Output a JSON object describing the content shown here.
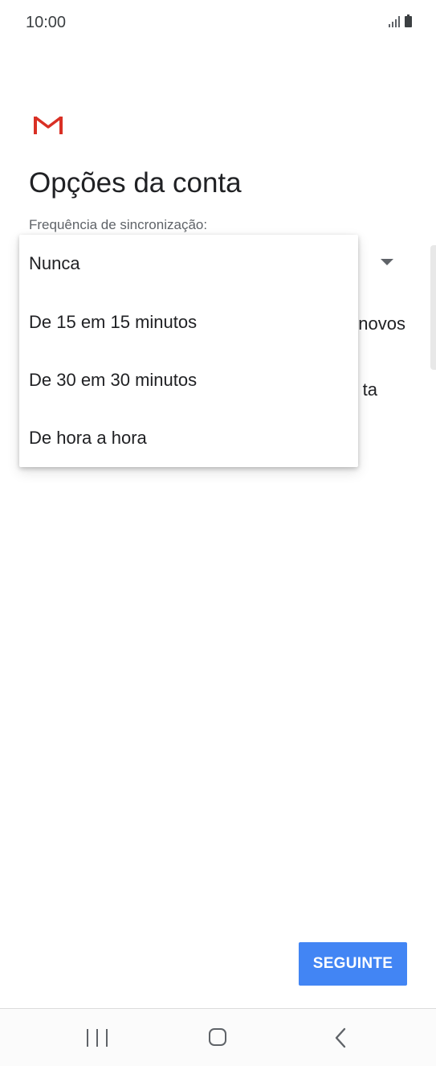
{
  "status_bar": {
    "time": "10:00"
  },
  "app": {
    "logo": "gmail-logo",
    "title": "Opções da conta"
  },
  "sync_field": {
    "label": "Frequência de sincronização:"
  },
  "background": {
    "line1_fragment": "novos",
    "line2_fragment": "ta"
  },
  "dropdown": {
    "options": [
      "Nunca",
      "De 15 em 15 minutos",
      "De 30 em 30 minutos",
      "De hora a hora"
    ]
  },
  "actions": {
    "next_label": "SEGUINTE"
  },
  "colors": {
    "accent": "#4285f4",
    "gmail_red": "#d93025"
  }
}
